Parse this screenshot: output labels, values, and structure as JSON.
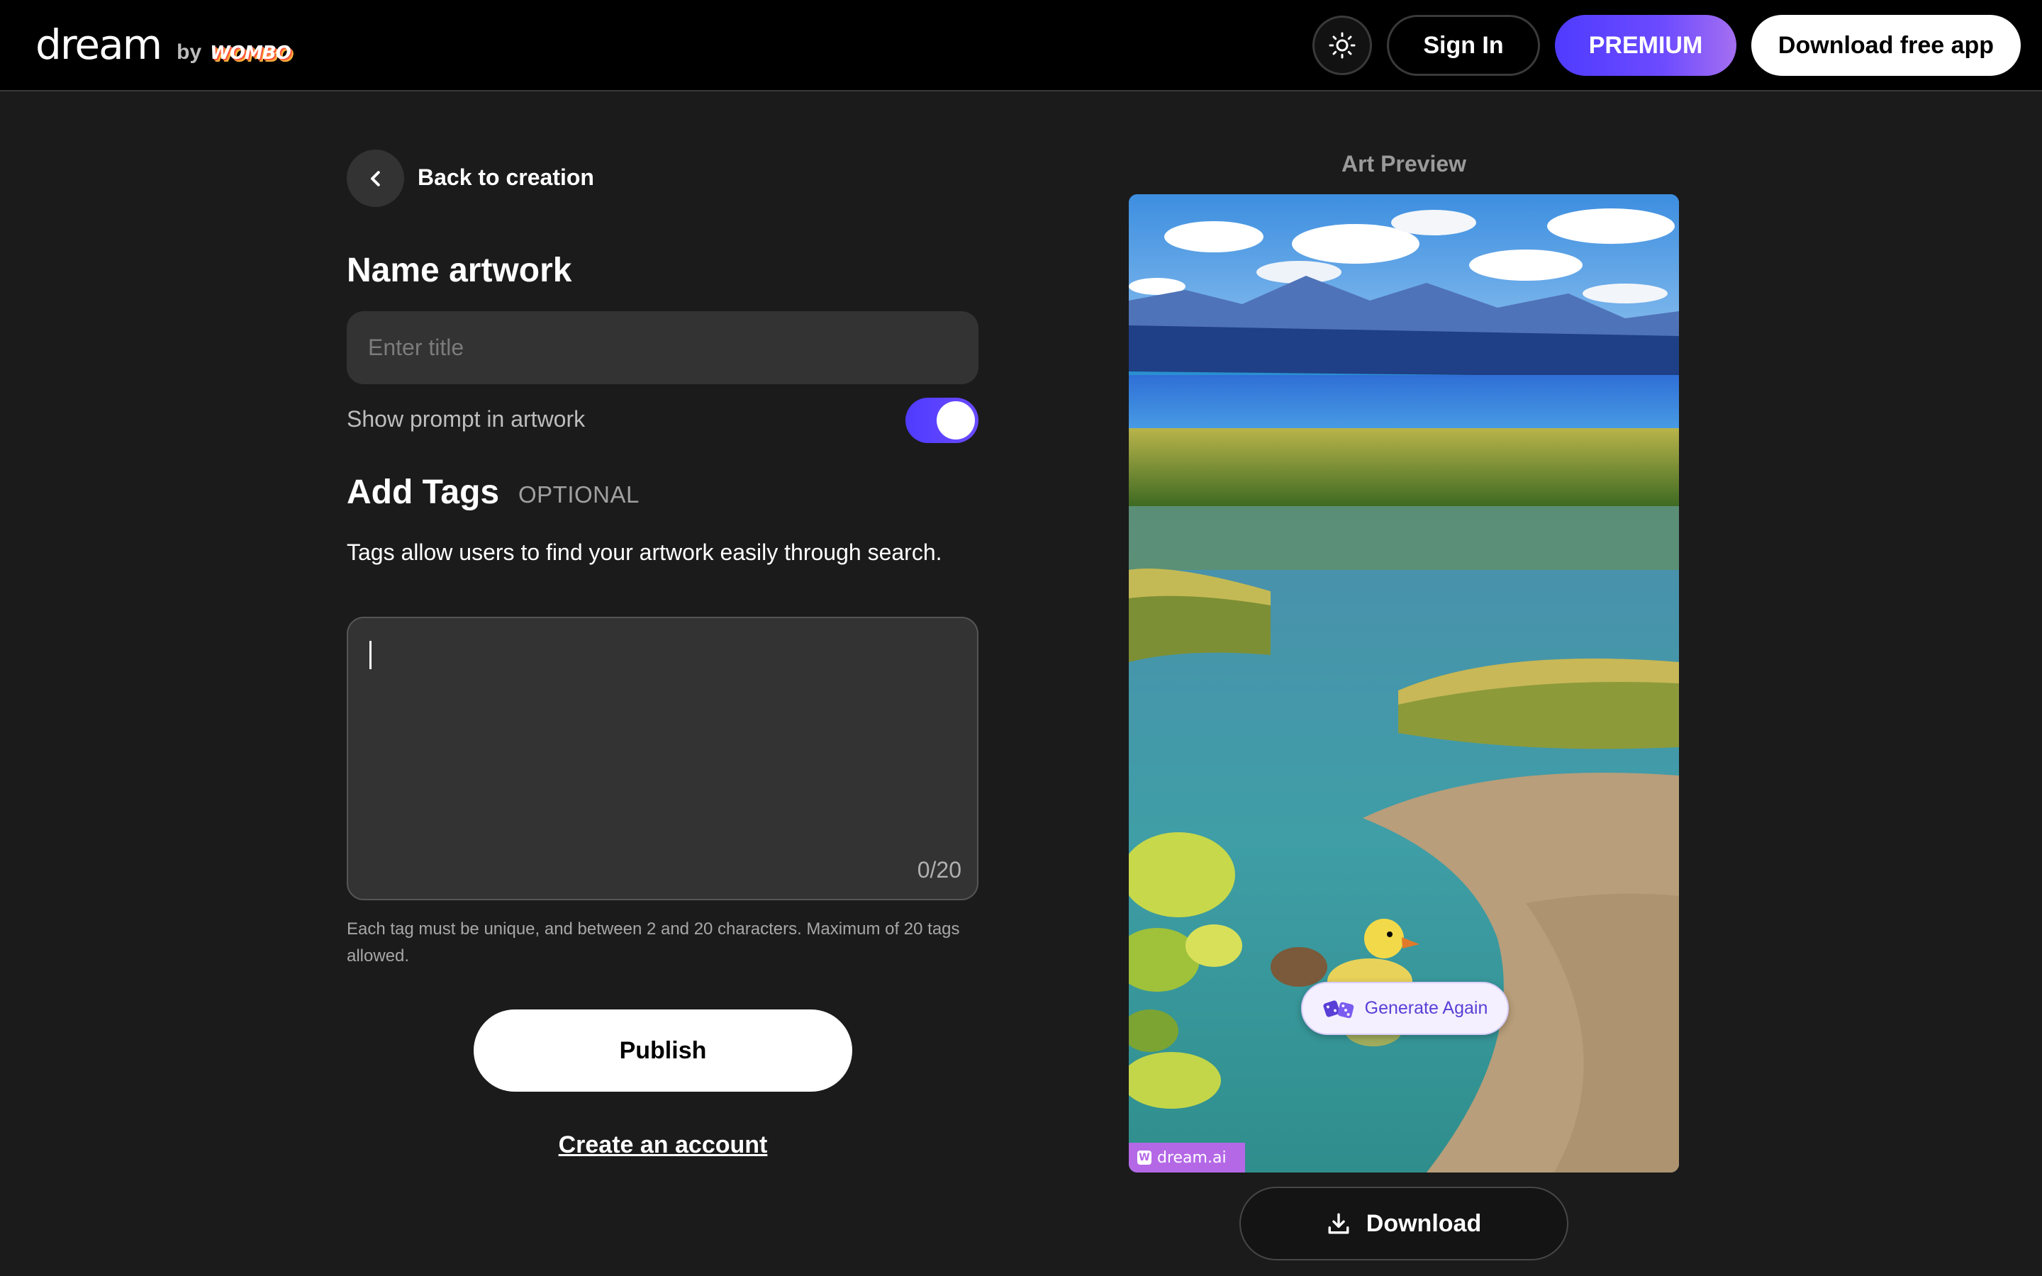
{
  "header": {
    "logo_word": "dream",
    "logo_by": "by",
    "logo_brand": "WOMBO",
    "theme_icon": "sun-icon",
    "sign_in": "Sign In",
    "premium": "PREMIUM",
    "download_app": "Download free app"
  },
  "form": {
    "back_label": "Back to creation",
    "back_icon": "chevron-left-icon",
    "name_title": "Name artwork",
    "title_placeholder": "Enter title",
    "title_value": "",
    "show_prompt_label": "Show prompt in artwork",
    "show_prompt_enabled": true,
    "tags_title": "Add Tags",
    "tags_optional": "OPTIONAL",
    "tags_description": "Tags allow users to find your artwork easily through search.",
    "tags_counter": "0/20",
    "tags_help": "Each tag must be unique, and between 2 and 20 characters. Maximum of 20 tags allowed.",
    "publish": "Publish",
    "create_account": "Create an account"
  },
  "preview": {
    "label": "Art Preview",
    "watermark": "dream.ai",
    "generate_again": "Generate Again",
    "generate_icon": "dice-icon",
    "download": "Download",
    "download_icon": "download-icon"
  },
  "colors": {
    "background": "#1b1b1b",
    "header": "#000000",
    "accent": "#4f3bff",
    "input": "#333333"
  }
}
